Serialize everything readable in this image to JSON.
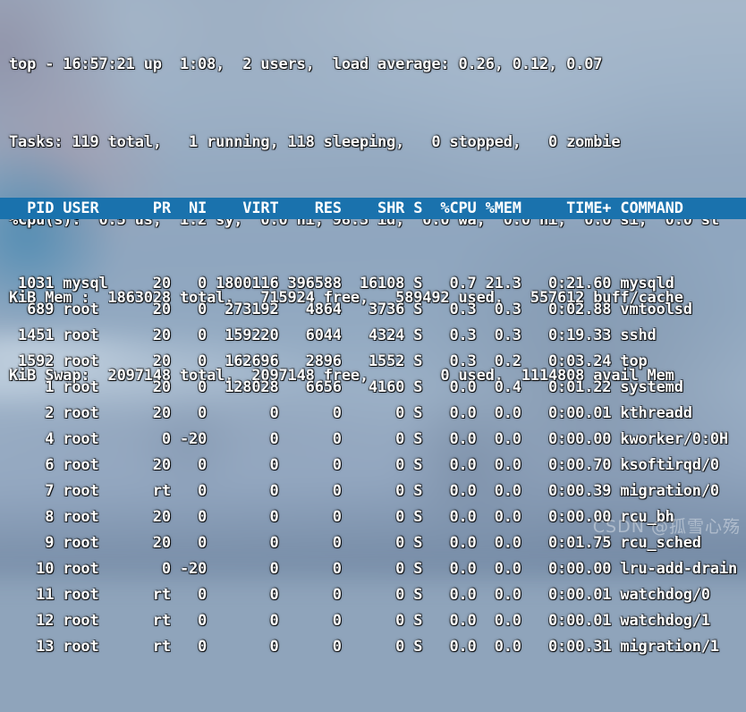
{
  "terminal": {
    "app": "top",
    "header_bg_color": "#1a72ad",
    "text_color": "#ffffff",
    "summary": {
      "uptime_line": "top - 16:57:21 up  1:08,  2 users,  load average: 0.26, 0.12, 0.07",
      "tasks_line": "Tasks: 119 total,   1 running, 118 sleeping,   0 stopped,   0 zombie",
      "cpu_line": "%Cpu(s):  0.5 us,  1.2 sy,  0.0 ni, 98.3 id,  0.0 wa,  0.0 hi,  0.0 si,  0.0 st",
      "mem_line": "KiB Mem :  1863028 total,   715924 free,   589492 used,   557612 buff/cache",
      "swap_line": "KiB Swap:  2097148 total,  2097148 free,        0 used.  1114808 avail Mem",
      "fields": {
        "time": "16:57:21",
        "uptime": "1:08",
        "users": "2",
        "load_avg_1": "0.26",
        "load_avg_5": "0.12",
        "load_avg_15": "0.07",
        "tasks_total": "119",
        "tasks_running": "1",
        "tasks_sleeping": "118",
        "tasks_stopped": "0",
        "tasks_zombie": "0",
        "cpu_us": "0.5",
        "cpu_sy": "1.2",
        "cpu_ni": "0.0",
        "cpu_id": "98.3",
        "cpu_wa": "0.0",
        "cpu_hi": "0.0",
        "cpu_si": "0.0",
        "cpu_st": "0.0",
        "mem_total": "1863028",
        "mem_free": "715924",
        "mem_used": "589492",
        "mem_buff_cache": "557612",
        "swap_total": "2097148",
        "swap_free": "2097148",
        "swap_used": "0",
        "avail_mem": "1114808"
      }
    },
    "table": {
      "header_text": "  PID USER      PR  NI    VIRT    RES    SHR S  %CPU %MEM     TIME+ COMMAND",
      "columns": [
        "PID",
        "USER",
        "PR",
        "NI",
        "VIRT",
        "RES",
        "SHR",
        "S",
        "%CPU",
        "%MEM",
        "TIME+",
        "COMMAND"
      ],
      "rows": [
        {
          "text": " 1031 mysql     20   0 1800116 396588  16108 S   0.7 21.3   0:21.60 mysqld",
          "pid": "1031",
          "user": "mysql",
          "pr": "20",
          "ni": "0",
          "virt": "1800116",
          "res": "396588",
          "shr": "16108",
          "s": "S",
          "cpu": "0.7",
          "mem": "21.3",
          "time": "0:21.60",
          "command": "mysqld"
        },
        {
          "text": "  689 root      20   0  273192   4864   3736 S   0.3  0.3   0:02.88 vmtoolsd",
          "pid": "689",
          "user": "root",
          "pr": "20",
          "ni": "0",
          "virt": "273192",
          "res": "4864",
          "shr": "3736",
          "s": "S",
          "cpu": "0.3",
          "mem": "0.3",
          "time": "0:02.88",
          "command": "vmtoolsd"
        },
        {
          "text": " 1451 root      20   0  159220   6044   4324 S   0.3  0.3   0:19.33 sshd",
          "pid": "1451",
          "user": "root",
          "pr": "20",
          "ni": "0",
          "virt": "159220",
          "res": "6044",
          "shr": "4324",
          "s": "S",
          "cpu": "0.3",
          "mem": "0.3",
          "time": "0:19.33",
          "command": "sshd"
        },
        {
          "text": " 1592 root      20   0  162696   2896   1552 S   0.3  0.2   0:03.24 top",
          "pid": "1592",
          "user": "root",
          "pr": "20",
          "ni": "0",
          "virt": "162696",
          "res": "2896",
          "shr": "1552",
          "s": "S",
          "cpu": "0.3",
          "mem": "0.2",
          "time": "0:03.24",
          "command": "top"
        },
        {
          "text": "    1 root      20   0  128028   6656   4160 S   0.0  0.4   0:01.22 systemd",
          "pid": "1",
          "user": "root",
          "pr": "20",
          "ni": "0",
          "virt": "128028",
          "res": "6656",
          "shr": "4160",
          "s": "S",
          "cpu": "0.0",
          "mem": "0.4",
          "time": "0:01.22",
          "command": "systemd"
        },
        {
          "text": "    2 root      20   0       0      0      0 S   0.0  0.0   0:00.01 kthreadd",
          "pid": "2",
          "user": "root",
          "pr": "20",
          "ni": "0",
          "virt": "0",
          "res": "0",
          "shr": "0",
          "s": "S",
          "cpu": "0.0",
          "mem": "0.0",
          "time": "0:00.01",
          "command": "kthreadd"
        },
        {
          "text": "    4 root       0 -20       0      0      0 S   0.0  0.0   0:00.00 kworker/0:0H",
          "pid": "4",
          "user": "root",
          "pr": "0",
          "ni": "-20",
          "virt": "0",
          "res": "0",
          "shr": "0",
          "s": "S",
          "cpu": "0.0",
          "mem": "0.0",
          "time": "0:00.00",
          "command": "kworker/0:0H"
        },
        {
          "text": "    6 root      20   0       0      0      0 S   0.0  0.0   0:00.70 ksoftirqd/0",
          "pid": "6",
          "user": "root",
          "pr": "20",
          "ni": "0",
          "virt": "0",
          "res": "0",
          "shr": "0",
          "s": "S",
          "cpu": "0.0",
          "mem": "0.0",
          "time": "0:00.70",
          "command": "ksoftirqd/0"
        },
        {
          "text": "    7 root      rt   0       0      0      0 S   0.0  0.0   0:00.39 migration/0",
          "pid": "7",
          "user": "root",
          "pr": "rt",
          "ni": "0",
          "virt": "0",
          "res": "0",
          "shr": "0",
          "s": "S",
          "cpu": "0.0",
          "mem": "0.0",
          "time": "0:00.39",
          "command": "migration/0"
        },
        {
          "text": "    8 root      20   0       0      0      0 S   0.0  0.0   0:00.00 rcu_bh",
          "pid": "8",
          "user": "root",
          "pr": "20",
          "ni": "0",
          "virt": "0",
          "res": "0",
          "shr": "0",
          "s": "S",
          "cpu": "0.0",
          "mem": "0.0",
          "time": "0:00.00",
          "command": "rcu_bh"
        },
        {
          "text": "    9 root      20   0       0      0      0 S   0.0  0.0   0:01.75 rcu_sched",
          "pid": "9",
          "user": "root",
          "pr": "20",
          "ni": "0",
          "virt": "0",
          "res": "0",
          "shr": "0",
          "s": "S",
          "cpu": "0.0",
          "mem": "0.0",
          "time": "0:01.75",
          "command": "rcu_sched"
        },
        {
          "text": "   10 root       0 -20       0      0      0 S   0.0  0.0   0:00.00 lru-add-drain",
          "pid": "10",
          "user": "root",
          "pr": "0",
          "ni": "-20",
          "virt": "0",
          "res": "0",
          "shr": "0",
          "s": "S",
          "cpu": "0.0",
          "mem": "0.0",
          "time": "0:00.00",
          "command": "lru-add-drain"
        },
        {
          "text": "   11 root      rt   0       0      0      0 S   0.0  0.0   0:00.01 watchdog/0",
          "pid": "11",
          "user": "root",
          "pr": "rt",
          "ni": "0",
          "virt": "0",
          "res": "0",
          "shr": "0",
          "s": "S",
          "cpu": "0.0",
          "mem": "0.0",
          "time": "0:00.01",
          "command": "watchdog/0"
        },
        {
          "text": "   12 root      rt   0       0      0      0 S   0.0  0.0   0:00.01 watchdog/1",
          "pid": "12",
          "user": "root",
          "pr": "rt",
          "ni": "0",
          "virt": "0",
          "res": "0",
          "shr": "0",
          "s": "S",
          "cpu": "0.0",
          "mem": "0.0",
          "time": "0:00.01",
          "command": "watchdog/1"
        },
        {
          "text": "   13 root      rt   0       0      0      0 S   0.0  0.0   0:00.31 migration/1",
          "pid": "13",
          "user": "root",
          "pr": "rt",
          "ni": "0",
          "virt": "0",
          "res": "0",
          "shr": "0",
          "s": "S",
          "cpu": "0.0",
          "mem": "0.0",
          "time": "0:00.31",
          "command": "migration/1"
        }
      ]
    }
  },
  "watermark": {
    "text": "CSDN @孤雪心殇"
  }
}
